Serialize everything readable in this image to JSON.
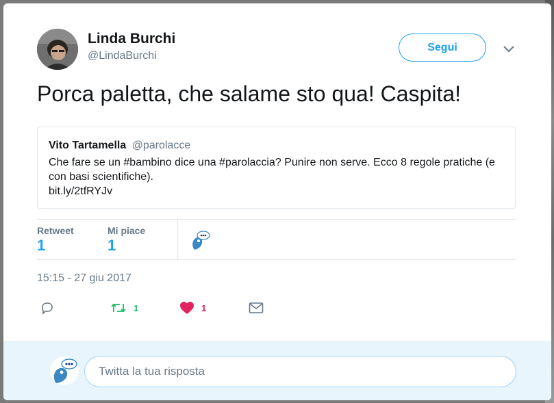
{
  "author": {
    "name": "Linda Burchi",
    "handle": "@LindaBurchi"
  },
  "follow_label": "Segui",
  "tweet_text": "Porca paletta, che salame sto qua! Caspita!",
  "quoted_tweet": {
    "name": "Vito Tartamella",
    "handle": "@parolacce",
    "text": "Che fare se un #bambino dice una #parolaccia? Punire non serve. Ecco 8 regole pratiche (e con basi scientifiche).",
    "link": "bit.ly/2tfRYJv"
  },
  "stats": {
    "retweets_label": "Retweet",
    "retweets_value": "1",
    "likes_label": "Mi piace",
    "likes_value": "1"
  },
  "timestamp": "15:15 - 27 giu 2017",
  "actions": {
    "retweet_count": "1",
    "like_count": "1"
  },
  "reply": {
    "placeholder": "Twitta la tua risposta"
  },
  "colors": {
    "accent": "#1da1f2",
    "retweet": "#17bf63",
    "like": "#e0245e",
    "muted": "#657786"
  },
  "icons": [
    "caret-down-icon",
    "reply-icon",
    "retweet-icon",
    "heart-icon",
    "message-icon"
  ]
}
